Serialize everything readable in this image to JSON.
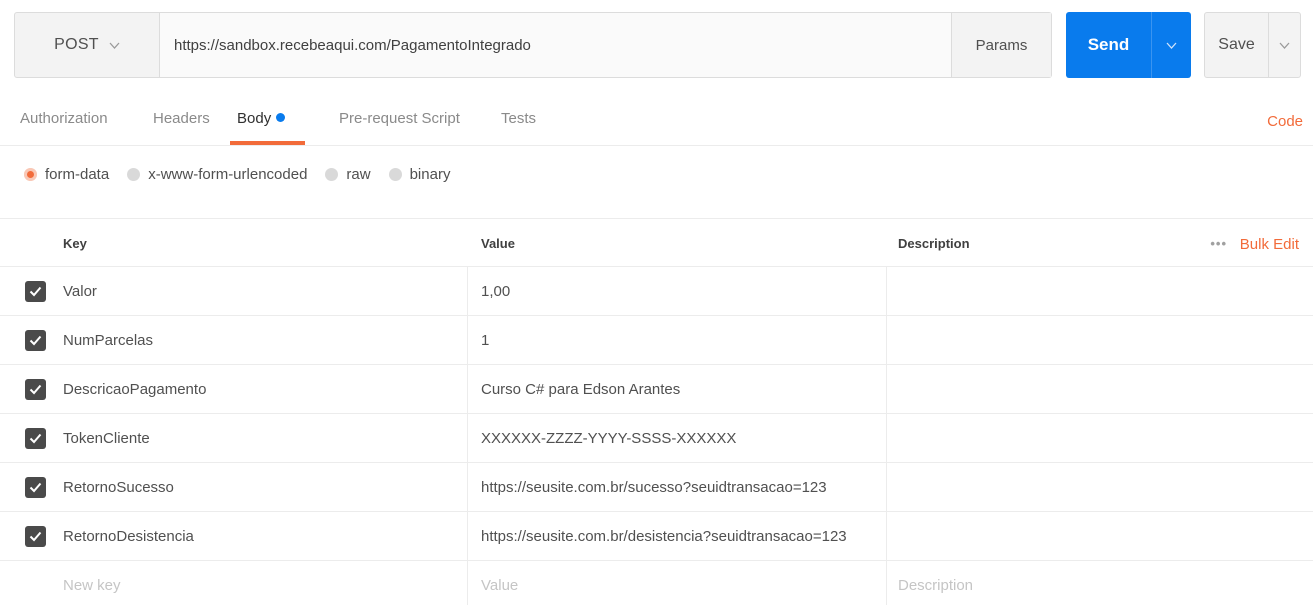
{
  "request": {
    "method": "POST",
    "url": "https://sandbox.recebeaqui.com/PagamentoIntegrado",
    "params_label": "Params",
    "send_label": "Send",
    "save_label": "Save"
  },
  "tabs": [
    {
      "label": "Authorization"
    },
    {
      "label": "Headers"
    },
    {
      "label": "Body"
    },
    {
      "label": "Pre-request Script"
    },
    {
      "label": "Tests"
    }
  ],
  "code_label": "Code",
  "body_types": [
    {
      "label": "form-data",
      "selected": true
    },
    {
      "label": "x-www-form-urlencoded",
      "selected": false
    },
    {
      "label": "raw",
      "selected": false
    },
    {
      "label": "binary",
      "selected": false
    }
  ],
  "table": {
    "headers": {
      "key": "Key",
      "value": "Value",
      "description": "Description"
    },
    "more_label": "•••",
    "bulk_edit_label": "Bulk Edit",
    "rows": [
      {
        "key": "Valor",
        "value": "1,00",
        "description": ""
      },
      {
        "key": "NumParcelas",
        "value": "1",
        "description": ""
      },
      {
        "key": "DescricaoPagamento",
        "value": "Curso C# para Edson Arantes",
        "description": ""
      },
      {
        "key": "TokenCliente",
        "value": "XXXXXX-ZZZZ-YYYY-SSSS-XXXXXX",
        "description": ""
      },
      {
        "key": "RetornoSucesso",
        "value": "https://seusite.com.br/sucesso?seuidtransacao=123",
        "description": ""
      },
      {
        "key": "RetornoDesistencia",
        "value": "https://seusite.com.br/desistencia?seuidtransacao=123",
        "description": ""
      }
    ],
    "new_row": {
      "key_placeholder": "New key",
      "value_placeholder": "Value",
      "description_placeholder": "Description"
    }
  },
  "colors": {
    "accent": "#f26b3a",
    "send_blue": "#097bed"
  }
}
